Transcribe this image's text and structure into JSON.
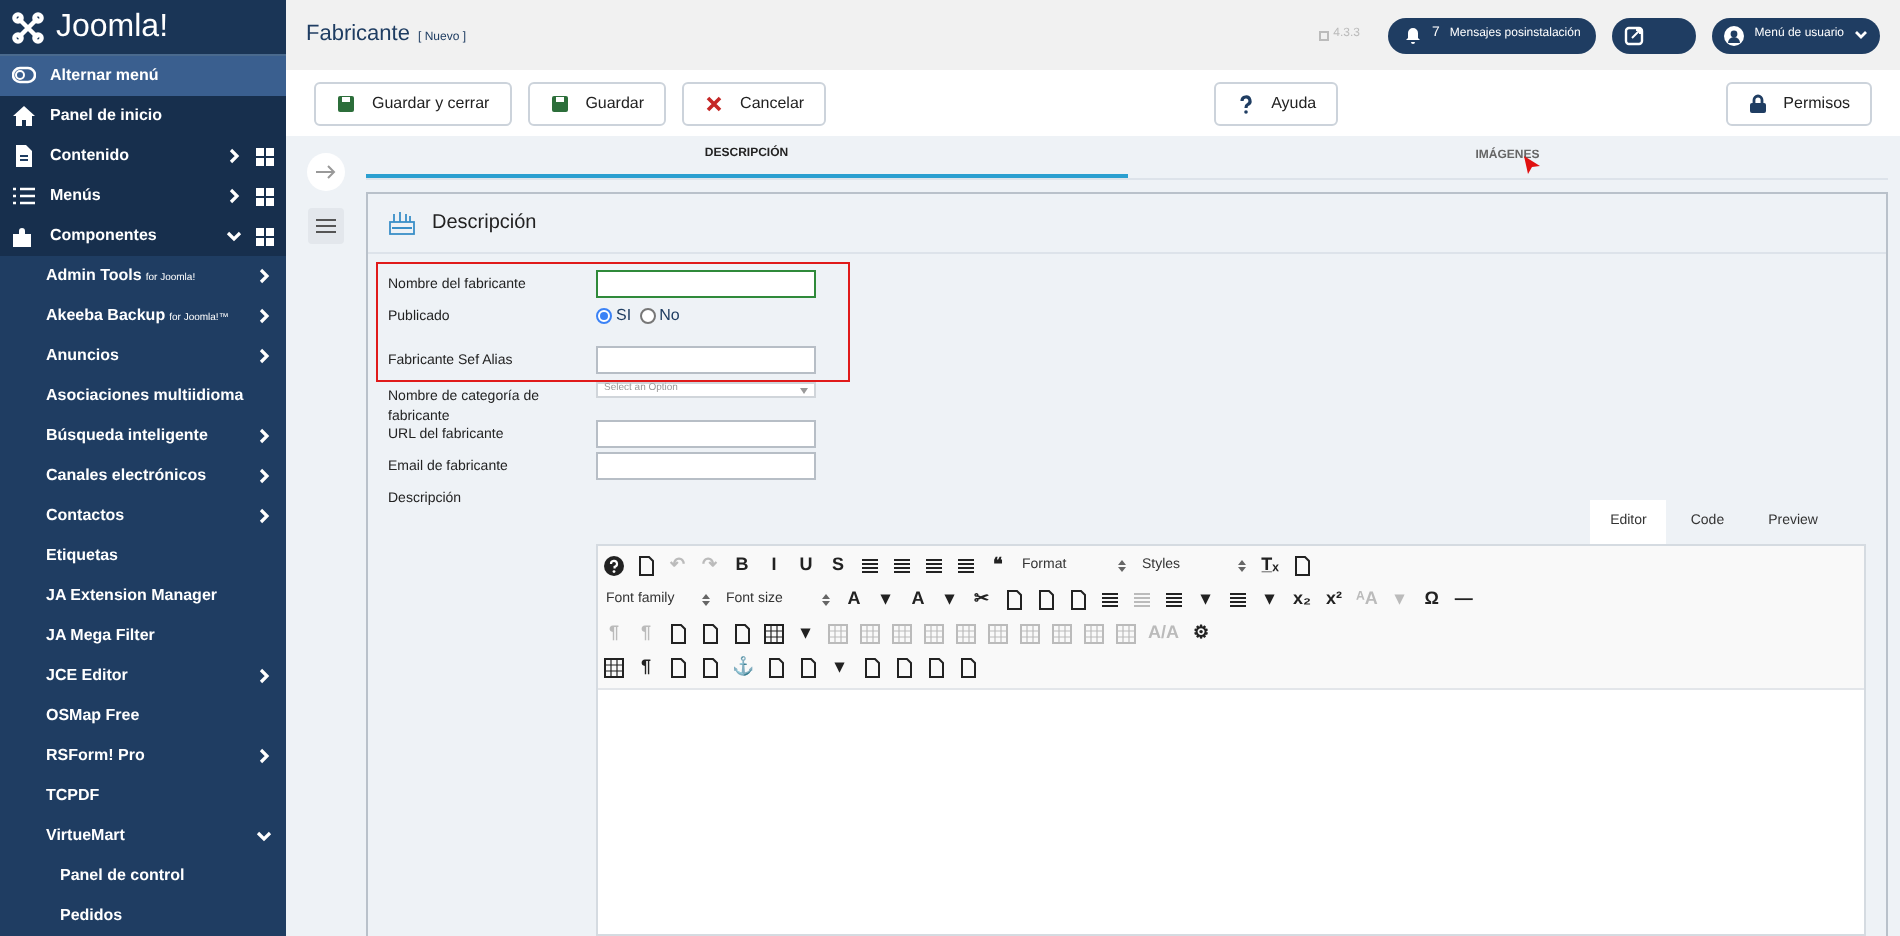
{
  "sidebar": {
    "logo": "Joomla!",
    "items": [
      {
        "label": "Alternar menú",
        "selected": true,
        "grid": false
      },
      {
        "label": "Panel de inicio",
        "selected": false,
        "grid": false
      },
      {
        "label": "Contenido",
        "selected": false,
        "expanded": false,
        "grid": true
      },
      {
        "label": "Menús",
        "selected": false,
        "expanded": false,
        "grid": true
      },
      {
        "label": "Componentes",
        "selected": false,
        "expanded": true,
        "grid": true,
        "children": [
          {
            "label": "Admin Tools",
            "suffix": "for Joomla!",
            "expanded": false
          },
          {
            "label": "Akeeba Backup",
            "suffix": "for Joomla!™",
            "expanded": false
          },
          {
            "label": "Anuncios",
            "expanded": false
          },
          {
            "label": "Asociaciones multiidioma"
          },
          {
            "label": "Búsqueda inteligente",
            "expanded": false
          },
          {
            "label": "Canales electrónicos",
            "expanded": false
          },
          {
            "label": "Contactos",
            "expanded": false
          },
          {
            "label": "Etiquetas"
          },
          {
            "label": "JA Extension Manager"
          },
          {
            "label": "JA Mega Filter"
          },
          {
            "label": "JCE Editor",
            "expanded": false
          },
          {
            "label": "OSMap Free"
          },
          {
            "label": "RSForm! Pro",
            "expanded": false
          },
          {
            "label": "TCPDF"
          },
          {
            "label": "VirtueMart",
            "expanded": true,
            "children": [
              {
                "label": "Panel de control"
              },
              {
                "label": "Pedidos"
              }
            ]
          }
        ]
      }
    ]
  },
  "header": {
    "title": "Fabricante",
    "subtitle": "[ Nuevo ]",
    "version": "4.3.3",
    "notifications": {
      "count": "7",
      "label": "Mensajes posinstalación"
    },
    "user_menu": "Menú de usuario"
  },
  "toolbar": [
    {
      "label": "Guardar y cerrar",
      "kind": "save"
    },
    {
      "label": "Guardar",
      "kind": "save"
    },
    {
      "label": "Cancelar",
      "kind": "cancel"
    },
    {
      "label": "Ayuda",
      "kind": "help"
    },
    {
      "label": "Permisos",
      "kind": "lock"
    }
  ],
  "tabs": [
    {
      "label": "DESCRIPCIÓN",
      "selected": true
    },
    {
      "label": "IMÁGENES",
      "selected": false
    }
  ],
  "panel": {
    "title": "Descripción",
    "fields": [
      {
        "label": "Nombre del fabricante",
        "kind": "text",
        "focused": true,
        "highlighted": true
      },
      {
        "label": "Publicado",
        "kind": "radio",
        "highlighted": true,
        "options": [
          {
            "label": "SI",
            "selected": true
          },
          {
            "label": "No",
            "selected": false
          }
        ]
      },
      {
        "label": "Fabricante Sef Alias",
        "kind": "text",
        "focused": false,
        "highlighted": true
      },
      {
        "label": "Nombre de categoría de fabricante",
        "kind": "select",
        "placeholder": "Select an Option",
        "highlighted": false
      },
      {
        "label": "URL del fabricante",
        "kind": "text",
        "focused": false,
        "highlighted": false
      },
      {
        "label": "Email de fabricante",
        "kind": "text",
        "focused": false,
        "highlighted": false
      },
      {
        "label": "Descripción",
        "kind": "label",
        "highlighted": false
      }
    ],
    "editor_tabs": [
      {
        "label": "Editor",
        "selected": true
      },
      {
        "label": "Code",
        "selected": false
      },
      {
        "label": "Preview",
        "selected": false
      }
    ],
    "editor_toolbar": [
      [
        {
          "kind": "help"
        },
        {
          "kind": "doc"
        },
        {
          "kind": "text",
          "text": "↶",
          "disabled": true
        },
        {
          "kind": "text",
          "text": "↷",
          "disabled": true
        },
        {
          "kind": "text",
          "text": "B"
        },
        {
          "kind": "text",
          "text": "I"
        },
        {
          "kind": "text",
          "text": "U"
        },
        {
          "kind": "text",
          "text": "S"
        },
        {
          "kind": "lines"
        },
        {
          "kind": "lines"
        },
        {
          "kind": "lines"
        },
        {
          "kind": "lines"
        },
        {
          "kind": "text",
          "text": "❝"
        },
        {
          "kind": "select",
          "text": "Format"
        },
        {
          "kind": "select",
          "text": "Styles"
        },
        {
          "kind": "text",
          "text": "T̲ₓ"
        },
        {
          "kind": "doc"
        }
      ],
      [
        {
          "kind": "select",
          "text": "Font family"
        },
        {
          "kind": "select",
          "text": "Font size"
        },
        {
          "kind": "text",
          "text": "A"
        },
        {
          "kind": "text",
          "text": "▾"
        },
        {
          "kind": "text",
          "text": "A"
        },
        {
          "kind": "text",
          "text": "▾"
        },
        {
          "kind": "text",
          "text": "✂"
        },
        {
          "kind": "doc"
        },
        {
          "kind": "doc"
        },
        {
          "kind": "doc"
        },
        {
          "kind": "lines"
        },
        {
          "kind": "lines",
          "disabled": true
        },
        {
          "kind": "lines"
        },
        {
          "kind": "text",
          "text": "▾"
        },
        {
          "kind": "lines"
        },
        {
          "kind": "text",
          "text": "▾"
        },
        {
          "kind": "text",
          "text": "x₂"
        },
        {
          "kind": "text",
          "text": "x²"
        },
        {
          "kind": "text",
          "text": "ᴬA",
          "disabled": true
        },
        {
          "kind": "text",
          "text": "▾",
          "disabled": true
        },
        {
          "kind": "text",
          "text": "Ω"
        },
        {
          "kind": "text",
          "text": "—"
        }
      ],
      [
        {
          "kind": "text",
          "text": "¶",
          "disabled": true
        },
        {
          "kind": "text",
          "text": "¶",
          "disabled": true
        },
        {
          "kind": "doc"
        },
        {
          "kind": "doc"
        },
        {
          "kind": "doc"
        },
        {
          "kind": "grid"
        },
        {
          "kind": "text",
          "text": "▾"
        },
        {
          "kind": "grid",
          "disabled": true
        },
        {
          "kind": "grid",
          "disabled": true
        },
        {
          "kind": "grid",
          "disabled": true
        },
        {
          "kind": "grid",
          "disabled": true
        },
        {
          "kind": "grid",
          "disabled": true
        },
        {
          "kind": "grid",
          "disabled": true
        },
        {
          "kind": "grid",
          "disabled": true
        },
        {
          "kind": "grid",
          "disabled": true
        },
        {
          "kind": "grid",
          "disabled": true
        },
        {
          "kind": "grid",
          "disabled": true
        },
        {
          "kind": "text",
          "text": "A/A",
          "disabled": true
        },
        {
          "kind": "text",
          "text": "⚙"
        }
      ],
      [
        {
          "kind": "grid"
        },
        {
          "kind": "text",
          "text": "¶"
        },
        {
          "kind": "doc"
        },
        {
          "kind": "doc"
        },
        {
          "kind": "text",
          "text": "⚓"
        },
        {
          "kind": "doc"
        },
        {
          "kind": "doc"
        },
        {
          "kind": "text",
          "text": "▾"
        },
        {
          "kind": "doc"
        },
        {
          "kind": "doc"
        },
        {
          "kind": "doc"
        },
        {
          "kind": "doc"
        }
      ]
    ]
  }
}
